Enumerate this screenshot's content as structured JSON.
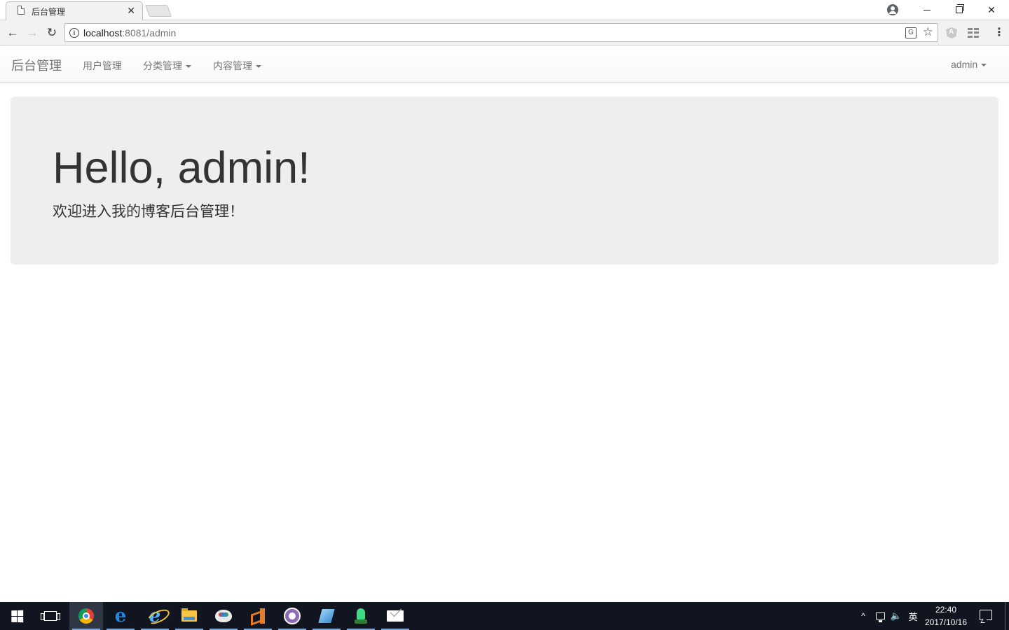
{
  "browser": {
    "tab_title": "后台管理",
    "tab_close": "✕",
    "url_host": "localhost",
    "url_rest": ":8081/admin",
    "window_controls": {
      "minimize": "minimize-icon",
      "maximize": "restore-icon",
      "close": "✕"
    },
    "nav": {
      "back": "←",
      "forward": "→",
      "reload": "↻"
    },
    "star": "☆",
    "menu": "⋮",
    "translate": "G",
    "info": "i",
    "extension_letter": "A"
  },
  "navbar": {
    "brand": "后台管理",
    "items": [
      {
        "label": "用户管理",
        "dropdown": false
      },
      {
        "label": "分类管理",
        "dropdown": true
      },
      {
        "label": "内容管理",
        "dropdown": true
      }
    ],
    "user": {
      "label": "admin",
      "dropdown": true
    }
  },
  "jumbotron": {
    "title": "Hello, admin!",
    "lead": "欢迎进入我的博客后台管理！"
  },
  "taskbar": {
    "apps": [
      "start-icon",
      "task-view-icon",
      "chrome-icon",
      "edge-icon",
      "ie-icon",
      "file-explorer-icon",
      "paint-icon",
      "vscode-icon",
      "github-desktop-icon",
      "notepad-icon",
      "android-studio-icon",
      "mail-icon"
    ],
    "tray": {
      "chevron": "^",
      "volume": "🔈",
      "ime": "英",
      "time": "22:40",
      "date": "2017/10/16"
    }
  },
  "colors": {
    "navbar_text": "#777777",
    "jumbotron_bg": "#eeeeee",
    "taskbar_bg": "#101520",
    "text": "#333333"
  }
}
